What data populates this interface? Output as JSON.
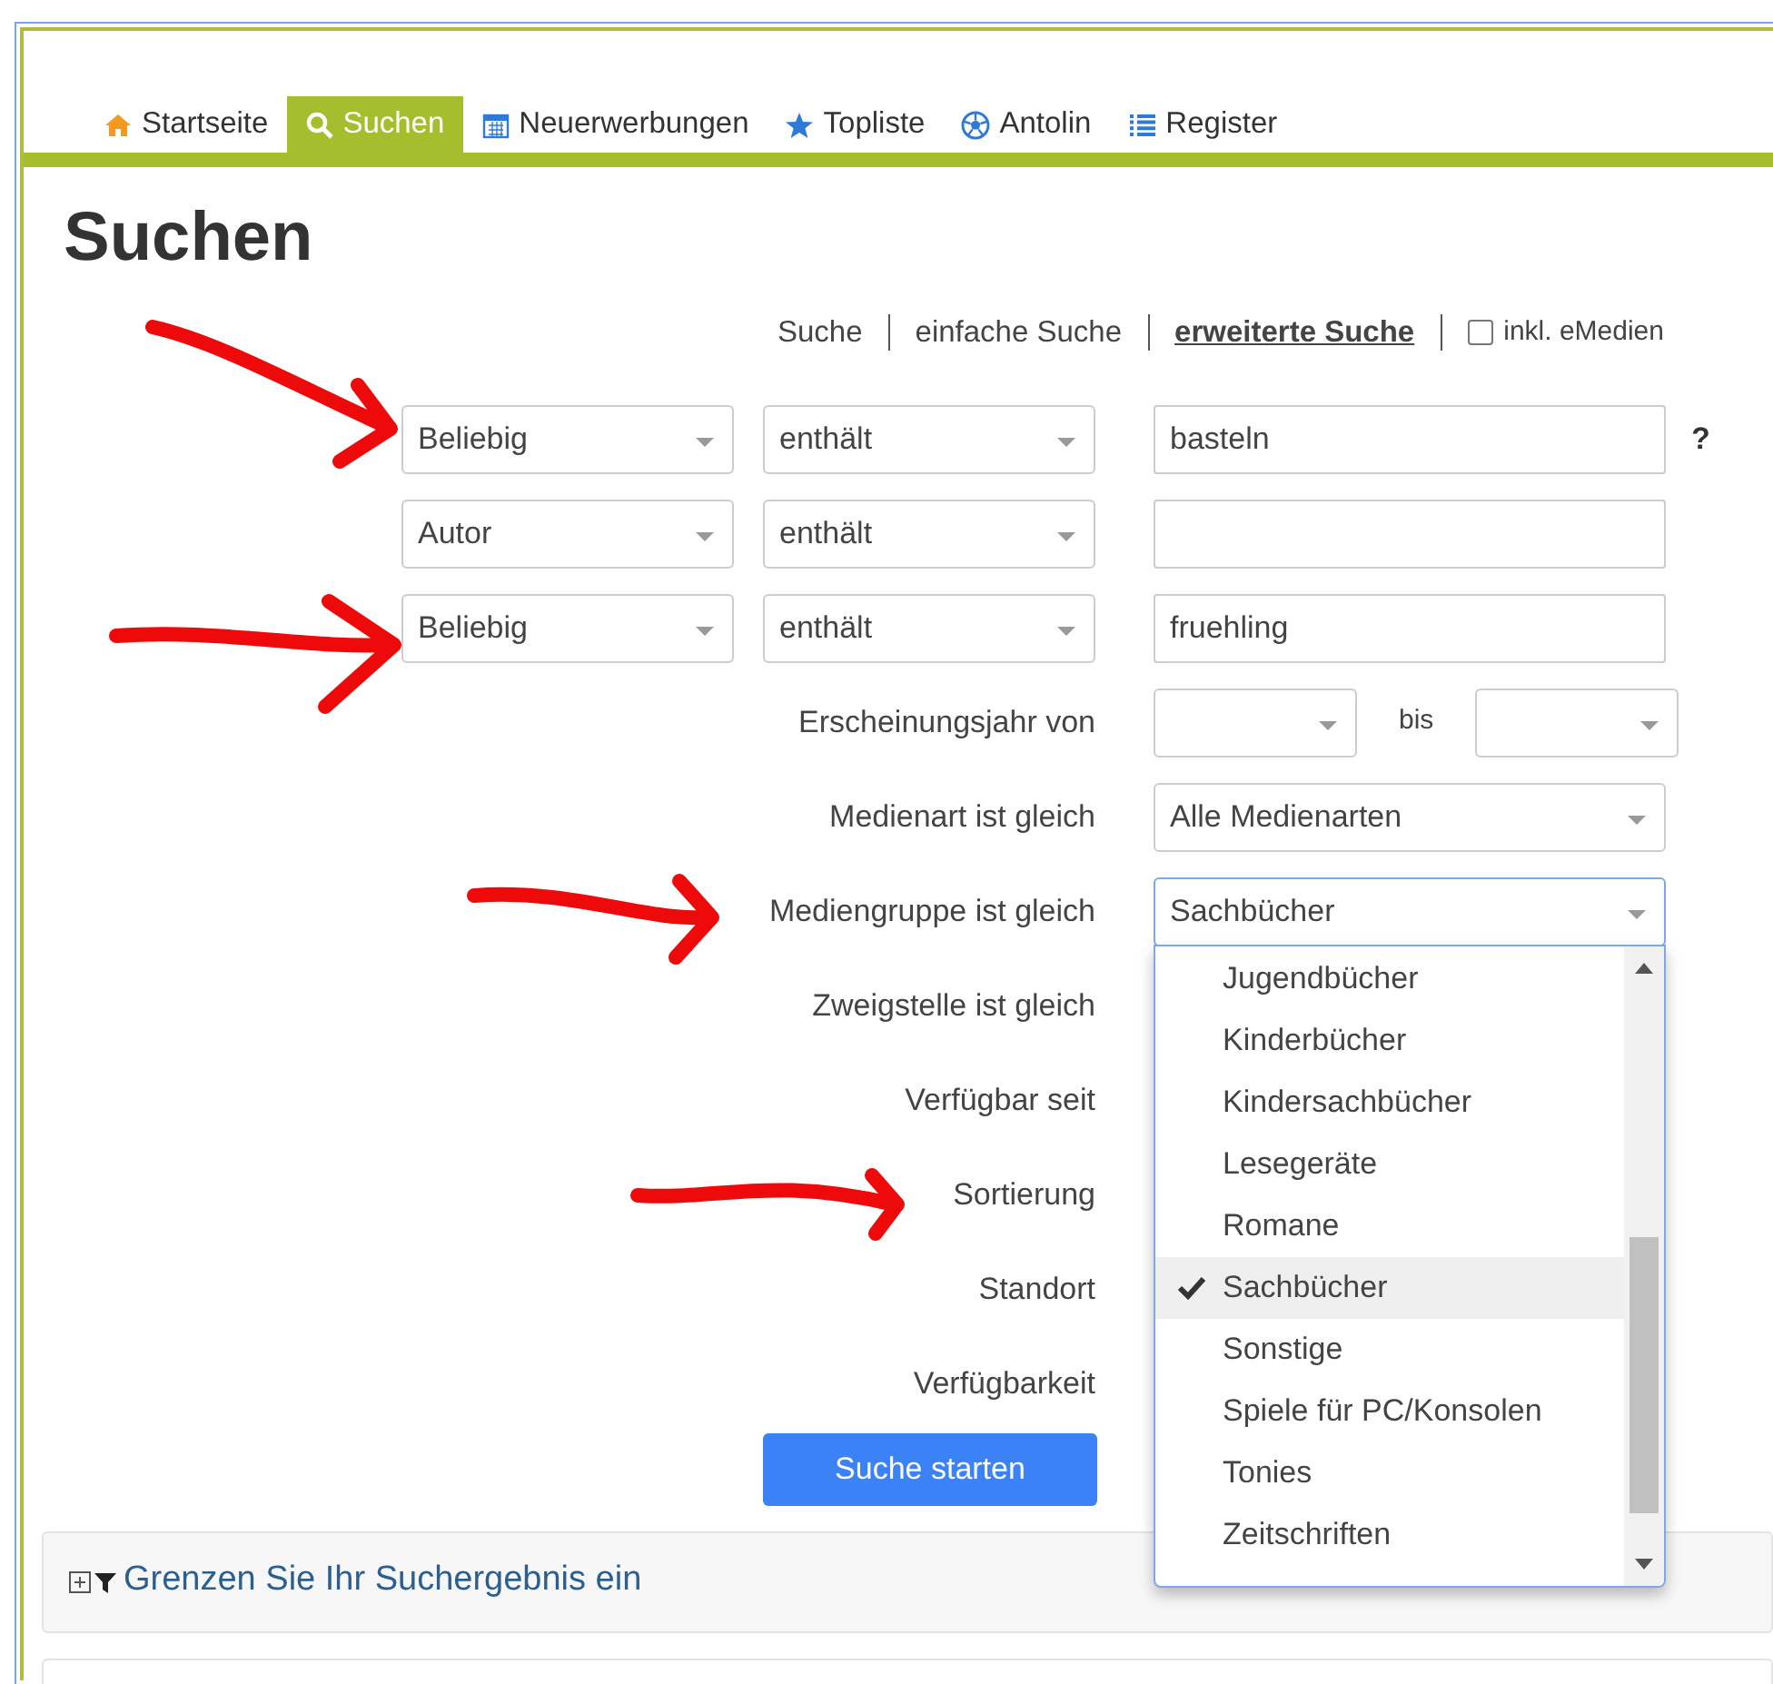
{
  "tabs": [
    {
      "label": "Startseite",
      "selected": false
    },
    {
      "label": "Suchen",
      "selected": true
    },
    {
      "label": "Neuerwerbungen",
      "selected": false
    },
    {
      "label": "Topliste",
      "selected": false
    },
    {
      "label": "Antolin",
      "selected": false
    },
    {
      "label": "Register",
      "selected": false
    }
  ],
  "title": "Suchen",
  "search_modes": [
    {
      "label": "Suche",
      "selected": false
    },
    {
      "label": "einfache Suche",
      "selected": false
    },
    {
      "label": "erweiterte Suche",
      "selected": true
    }
  ],
  "emedia": {
    "label": "inkl. eMedien",
    "checked": false
  },
  "criteria": [
    {
      "field": "Beliebig",
      "operator": "enthält",
      "value": "basteln",
      "help": "?",
      "annotated": true
    },
    {
      "field": "Autor",
      "operator": "enthält",
      "annotated": false
    },
    {
      "field": "Beliebig",
      "operator": "enthält",
      "value": "fruehling",
      "annotated": true
    }
  ],
  "filters": [
    {
      "kind": "year",
      "label": "Erscheinungsjahr von",
      "to_label": "bis",
      "annotated": false
    },
    {
      "kind": "select",
      "label": "Medienart ist gleich",
      "value": "Alle Medienarten",
      "annotated": false
    },
    {
      "kind": "select",
      "label": "Mediengruppe ist gleich",
      "value": "Sachbücher",
      "annotated": true,
      "open": true,
      "options": [
        {
          "label": "Jugendbücher",
          "selected": false
        },
        {
          "label": "Kinderbücher",
          "selected": false
        },
        {
          "label": "Kindersachbücher",
          "selected": false
        },
        {
          "label": "Lesegeräte",
          "selected": false
        },
        {
          "label": "Romane",
          "selected": false
        },
        {
          "label": "Sachbücher",
          "selected": true
        },
        {
          "label": "Sonstige",
          "selected": false
        },
        {
          "label": "Spiele für PC/Konsolen",
          "selected": false
        },
        {
          "label": "Tonies",
          "selected": false
        },
        {
          "label": "Zeitschriften",
          "selected": false
        }
      ]
    },
    {
      "kind": "hidden",
      "label": "Zweigstelle ist gleich",
      "annotated": false
    },
    {
      "kind": "hidden",
      "label": "Verfügbar seit",
      "annotated": false
    },
    {
      "kind": "hidden",
      "label": "Sortierung",
      "annotated": true
    },
    {
      "kind": "hidden",
      "label": "Standort",
      "annotated": false
    },
    {
      "kind": "hidden",
      "label": "Verfügbarkeit",
      "annotated": false
    }
  ],
  "submit": "Suche starten",
  "refine_panel": {
    "label": "Grenzen Sie Ihr Suchergebnis ein"
  }
}
